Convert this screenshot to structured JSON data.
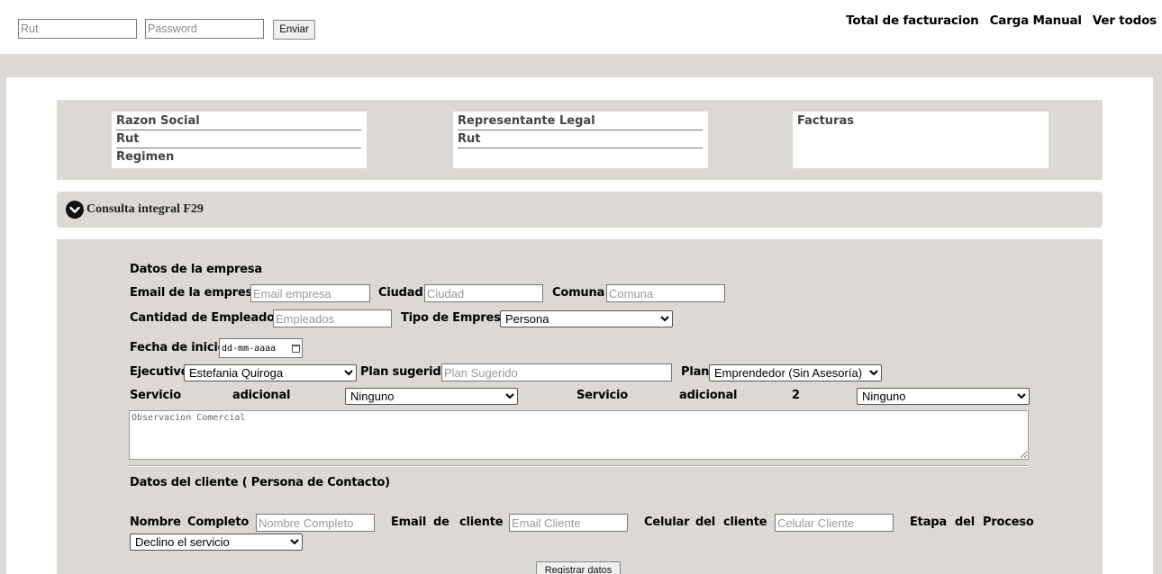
{
  "topbar": {
    "rut_placeholder": "Rut",
    "password_placeholder": "Password",
    "send_label": "Enviar",
    "nav": [
      "Total de facturacion",
      "Carga Manual",
      "Ver todos"
    ]
  },
  "info": {
    "empresa": [
      "Razon Social",
      "Rut",
      "Regimen"
    ],
    "representante": [
      "Representante Legal",
      "Rut"
    ],
    "facturas": "Facturas"
  },
  "accordion": {
    "icon": "chevron-down-icon",
    "title": "Consulta integral F29"
  },
  "form": {
    "section_empresa": "Datos de la empresa",
    "email_label": "Email de la empresa",
    "email_placeholder": "Email empresa",
    "ciudad_label": "Ciudad",
    "ciudad_placeholder": "Ciudad",
    "comuna_label": "Comuna",
    "comuna_placeholder": "Comuna",
    "empleados_label": "Cantidad de Empleados",
    "empleados_placeholder": "Empleados",
    "tipo_label": "Tipo de Empresa",
    "tipo_value": "Persona",
    "fecha_label": "Fecha de inicio",
    "fecha_placeholder": "dd-mm-aaaa",
    "ejecutivo_label": "Ejecutivo",
    "ejecutivo_value": "Estefania Quiroga",
    "plan_sugerido_label": "Plan sugerido",
    "plan_sugerido_placeholder": "Plan Sugerido",
    "plan_label": "Plan",
    "plan_value": "Emprendedor (Sin Asesoría)",
    "servicio_words": [
      "Servicio",
      "adicional"
    ],
    "servicio_value": "Ninguno",
    "servicio2_words": [
      "Servicio",
      "adicional",
      "2"
    ],
    "servicio2_value": "Ninguno",
    "observacion_placeholder": "Observacion Comercial",
    "section_cliente": "Datos del cliente ( Persona de Contacto)",
    "nombre_words": [
      "Nombre",
      "Completo"
    ],
    "nombre_placeholder": "Nombre Completo",
    "email_cliente_words": [
      "Email",
      "de",
      "cliente"
    ],
    "email_cliente_placeholder": "Email Cliente",
    "celular_words": [
      "Celular",
      "del",
      "cliente"
    ],
    "celular_placeholder": "Celular Cliente",
    "etapa_words": [
      "Etapa",
      "del",
      "Proceso"
    ],
    "etapa_value": "Declino el servicio",
    "submit_label": "Registrar datos"
  },
  "colors": {
    "panel": "#dcd9d4",
    "background": "#ffffff"
  }
}
